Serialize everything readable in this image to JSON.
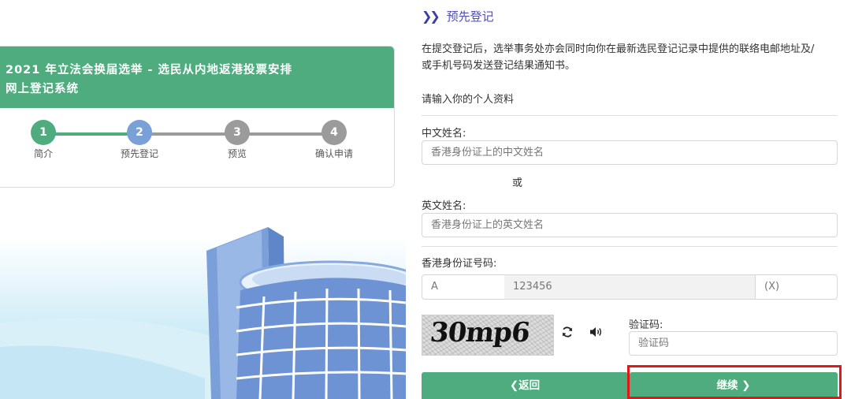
{
  "system": {
    "title_line1": "2021 年立法会换届选举 - 选民从内地返港投票安排",
    "title_line2": "网上登记系统"
  },
  "steps": [
    {
      "num": "1",
      "label": "简介",
      "state": "done"
    },
    {
      "num": "2",
      "label": "预先登记",
      "state": "active"
    },
    {
      "num": "3",
      "label": "预览",
      "state": "pending"
    },
    {
      "num": "4",
      "label": "确认申请",
      "state": "pending"
    }
  ],
  "colors": {
    "primary": "#4fac7f",
    "active_step": "#7aa0d8",
    "pending_step": "#9b9b9b",
    "highlight": "#e01818"
  },
  "section": {
    "title": "预先登记",
    "notice_line1": "在提交登记后，选举事务处亦会同时向你在最新选民登记记录中提供的联络电邮地址及/",
    "notice_line2": "或手机号码发送登记结果通知书。",
    "subheading": "请输入你的个人资料"
  },
  "form": {
    "chinese_name_label": "中文姓名:",
    "chinese_name_placeholder": "香港身份证上的中文姓名",
    "or_text": "或",
    "english_name_label": "英文姓名:",
    "english_name_placeholder": "香港身份证上的英文姓名",
    "hkid_label": "香港身份证号码:",
    "hkid_prefix_placeholder": "A",
    "hkid_digits_placeholder": "123456",
    "hkid_check_placeholder": "(X)",
    "captcha_text": "30mp6",
    "captcha_label": "验证码:",
    "captcha_placeholder": "验证码"
  },
  "buttons": {
    "back": "返回",
    "continue": "继续"
  }
}
